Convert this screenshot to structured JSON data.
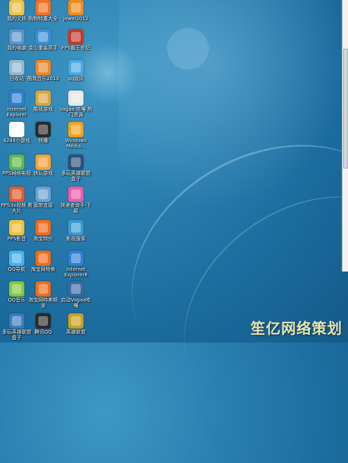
{
  "desktop": {
    "icons": [
      {
        "label": "我的文档",
        "color": "#e9c24a"
      },
      {
        "label": "购物特惠大全",
        "color": "#f2701f"
      },
      {
        "label": "Jewel2012",
        "color": "#f28c1a"
      },
      {
        "label": "我的电脑",
        "color": "#5b93c9"
      },
      {
        "label": "金山重装高手",
        "color": "#3c8ed8"
      },
      {
        "label": "FPS霸王世纪",
        "color": "#c23a2a"
      },
      {
        "label": "回收站",
        "color": "#8fb8cf"
      },
      {
        "label": "酷我音乐2013",
        "color": "#e7892a"
      },
      {
        "label": "qq旋风",
        "color": "#4aa8e0"
      },
      {
        "label": "Internet Explorer",
        "color": "#2f7fd0"
      },
      {
        "label": "酷我游戏",
        "color": "#d6a53b"
      },
      {
        "label": "Vagaa 哇嘎 热门资源",
        "color": "#e6e6e6"
      },
      {
        "label": "4244小游戏",
        "color": "#ffffff"
      },
      {
        "label": "快播",
        "color": "#2a2a2a"
      },
      {
        "label": "Windows Media...",
        "color": "#f2a11f"
      },
      {
        "label": "PPS网络电视",
        "color": "#5fb84a"
      },
      {
        "label": "快玩游戏",
        "color": "#f2a23a"
      },
      {
        "label": "多玩英雄联盟盒子",
        "color": "#2b4f7a"
      },
      {
        "label": "PPS.tv视频 看大片",
        "color": "#e35a2a"
      },
      {
        "label": "宽带连接",
        "color": "#6aa2cf"
      },
      {
        "label": "快递查询手-下载",
        "color": "#e85aa8"
      },
      {
        "label": "PPS影音",
        "color": "#f0c03a"
      },
      {
        "label": "淘宝特价",
        "color": "#f06a1a"
      },
      {
        "label": "影视搜索",
        "color": "#3a9ad0"
      },
      {
        "label": "QQ导航",
        "color": "#4ab0e8"
      },
      {
        "label": "淘宝网特卖",
        "color": "#f06a1a"
      },
      {
        "label": "Internet Explorer8",
        "color": "#2f7fd0"
      },
      {
        "label": "QQ音乐",
        "color": "#7fc83a"
      },
      {
        "label": "淘宝网特卖频道",
        "color": "#f06a1a"
      },
      {
        "label": "启动Vagaa哇嘎",
        "color": "#3a6aa0"
      },
      {
        "label": "多玩英雄联盟盒子",
        "color": "#3a7ab8"
      },
      {
        "label": "腾讯QQ",
        "color": "#2a2a2a"
      },
      {
        "label": "英雄联盟",
        "color": "#c8a020"
      }
    ]
  },
  "watermark": "笙亿网络策划"
}
